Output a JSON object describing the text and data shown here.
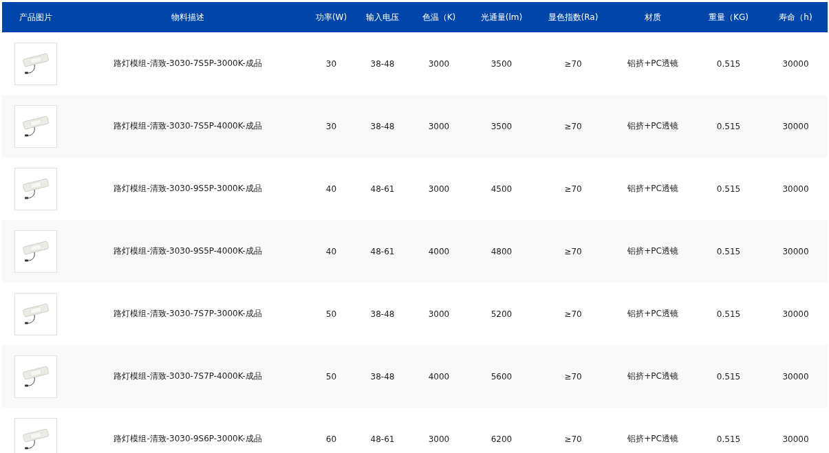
{
  "table": {
    "photo_column": "产品图片",
    "columns": [
      "物料描述",
      "功率(W)",
      "输入电压",
      "色温（K)",
      "光通量(lm)",
      "显色指数(Ra)",
      "材质",
      "重量（KG)",
      "寿命（h)"
    ],
    "rows": [
      {
        "cells": [
          "路灯模组-清致-3030-7S5P-3000K-成品",
          "30",
          "38-48",
          "3000",
          "3500",
          "≥70",
          "铝挤+PC透镜",
          "0.515",
          "30000"
        ]
      },
      {
        "cells": [
          "路灯模组-清致-3030-7S5P-4000K-成品",
          "30",
          "38-48",
          "3000",
          "3500",
          "≥70",
          "铝挤+PC透镜",
          "0.515",
          "30000"
        ]
      },
      {
        "cells": [
          "路灯模组-清致-3030-9S5P-3000K-成品",
          "40",
          "48-61",
          "3000",
          "4500",
          "≥70",
          "铝挤+PC透镜",
          "0.515",
          "30000"
        ]
      },
      {
        "cells": [
          "路灯模组-清致-3030-9S5P-4000K-成品",
          "40",
          "48-61",
          "4000",
          "4800",
          "≥70",
          "铝挤+PC透镜",
          "0.515",
          "30000"
        ]
      },
      {
        "cells": [
          "路灯模组-清致-3030-7S7P-3000K-成品",
          "50",
          "38-48",
          "3000",
          "5200",
          "≥70",
          "铝挤+PC透镜",
          "0.515",
          "30000"
        ]
      },
      {
        "cells": [
          "路灯模组-清致-3030-7S7P-4000K-成品",
          "50",
          "38-48",
          "4000",
          "5600",
          "≥70",
          "铝挤+PC透镜",
          "0.515",
          "30000"
        ]
      },
      {
        "cells": [
          "路灯模组-清致-3030-9S6P-3000K-成品",
          "60",
          "48-61",
          "3000",
          "6200",
          "≥70",
          "铝挤+PC透镜",
          "0.515",
          "30000"
        ]
      }
    ]
  }
}
